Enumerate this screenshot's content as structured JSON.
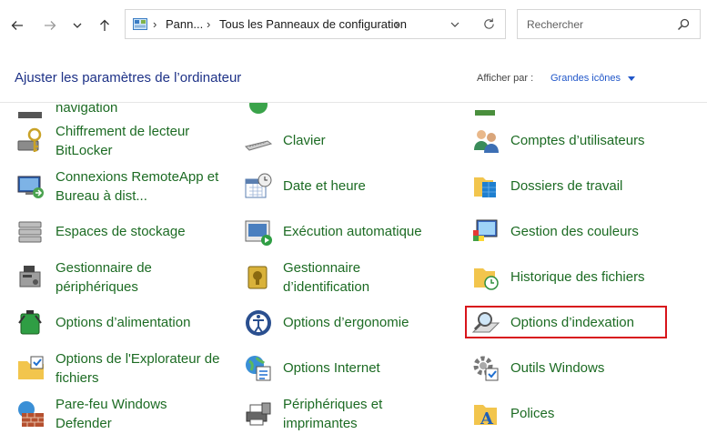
{
  "address": {
    "crumbs": [
      "Pann...",
      "Tous les Panneaux de configuration"
    ]
  },
  "search": {
    "placeholder": "Rechercher"
  },
  "header": {
    "title": "Ajuster les paramètres de l’ordinateur",
    "view_by_label": "Afficher par :",
    "view_by_value": "Grandes icônes"
  },
  "items": {
    "navigation": "navigation",
    "bitlocker": "Chiffrement de lecteur\nBitLocker",
    "clavier": "Clavier",
    "comptes": "Comptes d’utilisateurs",
    "remoteapp": "Connexions RemoteApp et\nBureau à dist...",
    "date": "Date et heure",
    "dossiers": "Dossiers de travail",
    "stockage": "Espaces de stockage",
    "execution": "Exécution automatique",
    "couleurs": "Gestion des couleurs",
    "peripheriques_gest": "Gestionnaire de\npériphériques",
    "identification": "Gestionnaire\nd’identification",
    "historique": "Historique des fichiers",
    "alimentation": "Options d’alimentation",
    "ergonomie": "Options d’ergonomie",
    "indexation": "Options d’indexation",
    "explorateur": "Options de l'Explorateur de\nfichiers",
    "internet": "Options Internet",
    "outils": "Outils Windows",
    "parefeu": "Pare-feu Windows\nDefender",
    "imprimantes": "Périphériques et\nimprimantes",
    "polices": "Polices"
  }
}
